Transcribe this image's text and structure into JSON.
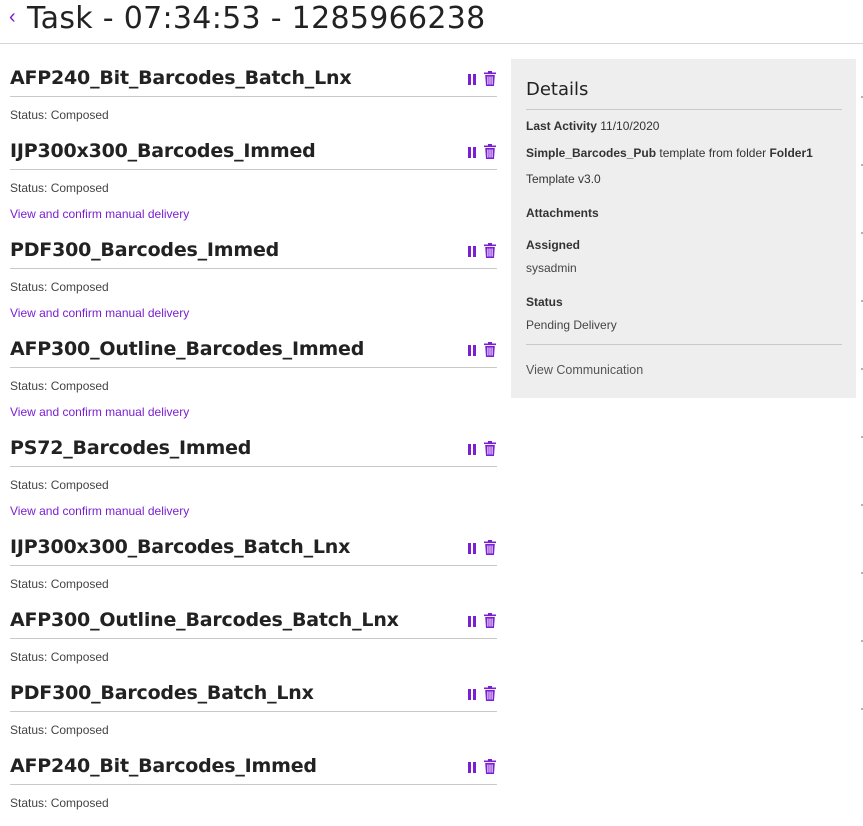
{
  "header": {
    "back_glyph": "‹",
    "title": "Task - 07:34:53 - 1285966238"
  },
  "colors": {
    "accent": "#7a1fd1",
    "panel_bg": "#eeeeee"
  },
  "tasks": [
    {
      "name": "AFP240_Bit_Barcodes_Batch_Lnx",
      "status": "Status: Composed",
      "link": ""
    },
    {
      "name": "IJP300x300_Barcodes_Immed",
      "status": "Status: Composed",
      "link": "View and confirm manual delivery"
    },
    {
      "name": "PDF300_Barcodes_Immed",
      "status": "Status: Composed",
      "link": "View and confirm manual delivery"
    },
    {
      "name": "AFP300_Outline_Barcodes_Immed",
      "status": "Status: Composed",
      "link": "View and confirm manual delivery"
    },
    {
      "name": "PS72_Barcodes_Immed",
      "status": "Status: Composed",
      "link": "View and confirm manual delivery"
    },
    {
      "name": "IJP300x300_Barcodes_Batch_Lnx",
      "status": "Status: Composed",
      "link": ""
    },
    {
      "name": "AFP300_Outline_Barcodes_Batch_Lnx",
      "status": "Status: Composed",
      "link": ""
    },
    {
      "name": "PDF300_Barcodes_Batch_Lnx",
      "status": "Status: Composed",
      "link": ""
    },
    {
      "name": "AFP240_Bit_Barcodes_Immed",
      "status": "Status: Composed",
      "link": ""
    }
  ],
  "details": {
    "title": "Details",
    "last_activity_label": "Last Activity",
    "last_activity_value": "11/10/2020",
    "template_name": "Simple_Barcodes_Pub",
    "template_from_text": "template from folder",
    "folder": "Folder1",
    "template_version": "Template v3.0",
    "attachments_label": "Attachments",
    "assigned_label": "Assigned",
    "assigned_value": "sysadmin",
    "status_label": "Status",
    "status_value": "Pending Delivery",
    "view_communication": "View Communication"
  },
  "icons": {
    "pause": "pause-icon",
    "trash": "trash-icon",
    "back": "chevron-left-icon"
  }
}
